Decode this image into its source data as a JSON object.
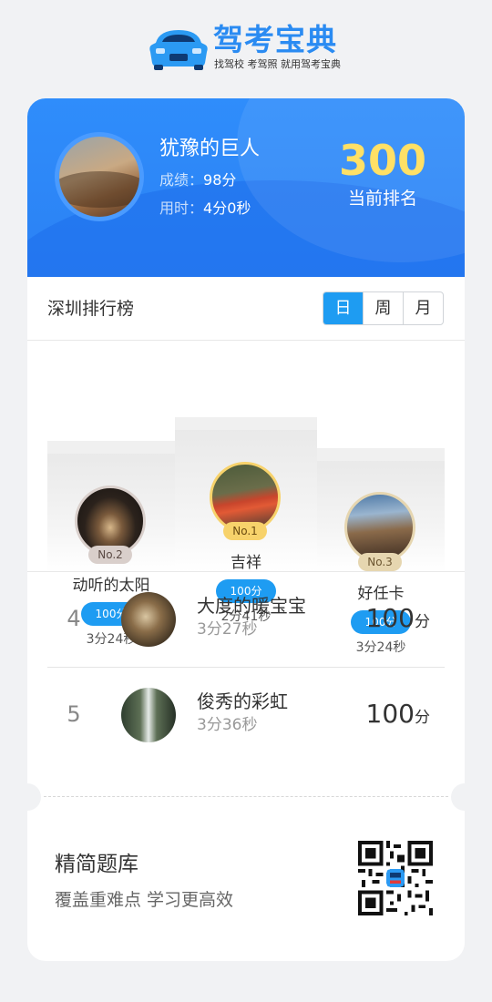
{
  "brand": {
    "name": "驾考宝典",
    "slogan": "找驾校 考驾照 就用驾考宝典",
    "color": "#2a8bf2"
  },
  "me": {
    "name": "犹豫的巨人",
    "score_label": "成绩：",
    "score_value": "98分",
    "time_label": "用时：",
    "time_value": "4分0秒",
    "rank": "300",
    "rank_label": "当前排名"
  },
  "board": {
    "title": "深圳排行榜",
    "tabs": [
      {
        "label": "日",
        "active": true
      },
      {
        "label": "周",
        "active": false
      },
      {
        "label": "月",
        "active": false
      }
    ]
  },
  "podium": [
    {
      "badge": "No.1",
      "name": "吉祥",
      "score": "100分",
      "time": "2分41秒"
    },
    {
      "badge": "No.2",
      "name": "动听的太阳",
      "score": "100分",
      "time": "3分24秒"
    },
    {
      "badge": "No.3",
      "name": "好任卡",
      "score": "100分",
      "time": "3分24秒"
    }
  ],
  "list": [
    {
      "rank": "4",
      "name": "大度的暖宝宝",
      "time": "3分27秒",
      "score": "100",
      "unit": "分"
    },
    {
      "rank": "5",
      "name": "俊秀的彩虹",
      "time": "3分36秒",
      "score": "100",
      "unit": "分"
    }
  ],
  "promo": {
    "title": "精简题库",
    "subtitle": "覆盖重难点 学习更高效"
  },
  "colors": {
    "hero": "#2f8dfb",
    "rank": "#ffe066",
    "accent": "#1e9cf2",
    "gold": "#f7d26b",
    "silver": "#d9cfcb",
    "bronze": "#e6d6b0"
  }
}
